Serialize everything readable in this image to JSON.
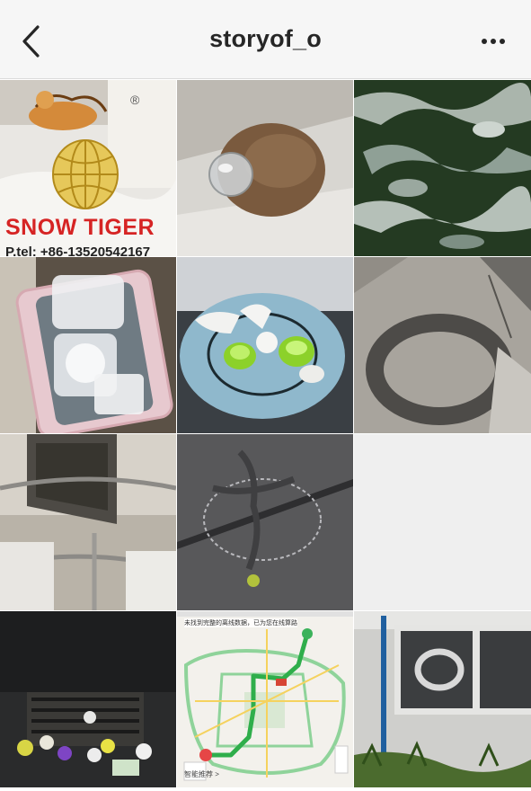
{
  "header": {
    "title": "storyof_o",
    "back_icon": "chevron-left-icon",
    "more_icon": "more-horizontal-icon"
  },
  "tiles": {
    "snow_tiger": {
      "brand": "SNOW TIGER",
      "registered_mark": "®",
      "tel": "P.tel: +86-13520542167"
    },
    "map": {
      "notice": "未找到完整的离线数据，已为您在线算路",
      "footer": "智能推荐 >"
    }
  }
}
